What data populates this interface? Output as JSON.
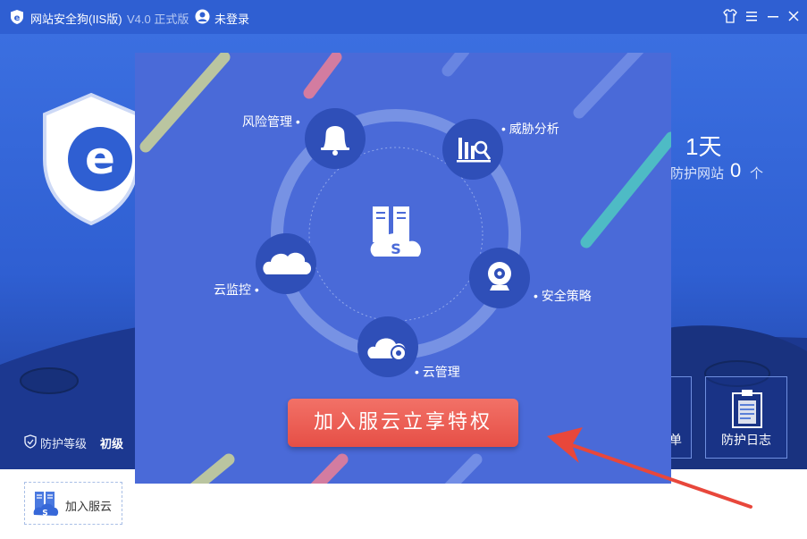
{
  "app": {
    "title": "网站安全狗(IIS版)",
    "version": "V4.0 正式版",
    "login_text": "未登录"
  },
  "stats": {
    "days": "1天",
    "protected_sites_label": "防护网站",
    "protected_sites_count": "0",
    "protected_sites_unit": "个"
  },
  "protection": {
    "level_label": "防护等级",
    "level_value": "初级"
  },
  "tools": {
    "partial_label": "单",
    "log_label": "防护日志"
  },
  "bottom": {
    "join_label": "加入服云"
  },
  "popup": {
    "center_icon": "cloud-server-icon",
    "nodes": {
      "risk": "风险管理 •",
      "threat": "• 威胁分析",
      "cloud_monitor": "云监控 •",
      "policy": "• 安全策略",
      "cloud_manage": "• 云管理"
    },
    "cta_label": "加入服云立享特权"
  },
  "colors": {
    "titlebar": "#2f5fd2",
    "popup_bg": "#4a6ad8",
    "cta": "#e64f46",
    "arrow": "#e8473b"
  }
}
